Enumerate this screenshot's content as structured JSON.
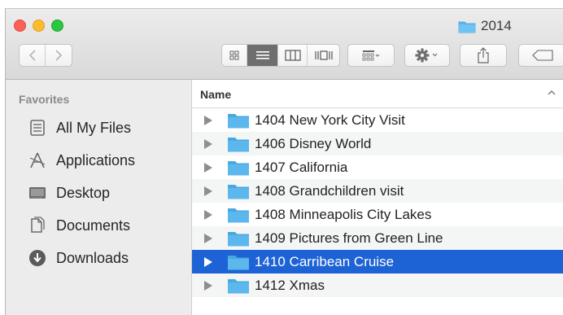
{
  "window": {
    "title": "2014"
  },
  "toolbar": {
    "back_icon": "chevron-left-icon",
    "forward_icon": "chevron-right-icon",
    "view_modes": [
      "icon-view-icon",
      "list-view-icon",
      "column-view-icon",
      "cover-flow-icon"
    ],
    "active_view": "list",
    "group_icon": "group-by-icon",
    "action_icon": "gear-icon",
    "share_icon": "share-icon",
    "tag_icon": "tag-icon"
  },
  "sidebar": {
    "heading": "Favorites",
    "items": [
      {
        "label": "All My Files",
        "icon": "all-my-files-icon"
      },
      {
        "label": "Applications",
        "icon": "applications-icon"
      },
      {
        "label": "Desktop",
        "icon": "desktop-icon"
      },
      {
        "label": "Documents",
        "icon": "documents-icon"
      },
      {
        "label": "Downloads",
        "icon": "downloads-icon"
      }
    ]
  },
  "list": {
    "column_header": "Name",
    "rows": [
      {
        "name": "1404 New York City Visit"
      },
      {
        "name": "1406 Disney World"
      },
      {
        "name": "1407 California"
      },
      {
        "name": "1408 Grandchildren visit"
      },
      {
        "name": "1408 Minneapolis City Lakes"
      },
      {
        "name": "1409 Pictures from Green Line"
      },
      {
        "name": "1410 Carribean Cruise",
        "selected": true
      },
      {
        "name": "1412 Xmas"
      }
    ]
  },
  "colors": {
    "selection": "#1e63d5",
    "folder": "#5bb7ec"
  }
}
